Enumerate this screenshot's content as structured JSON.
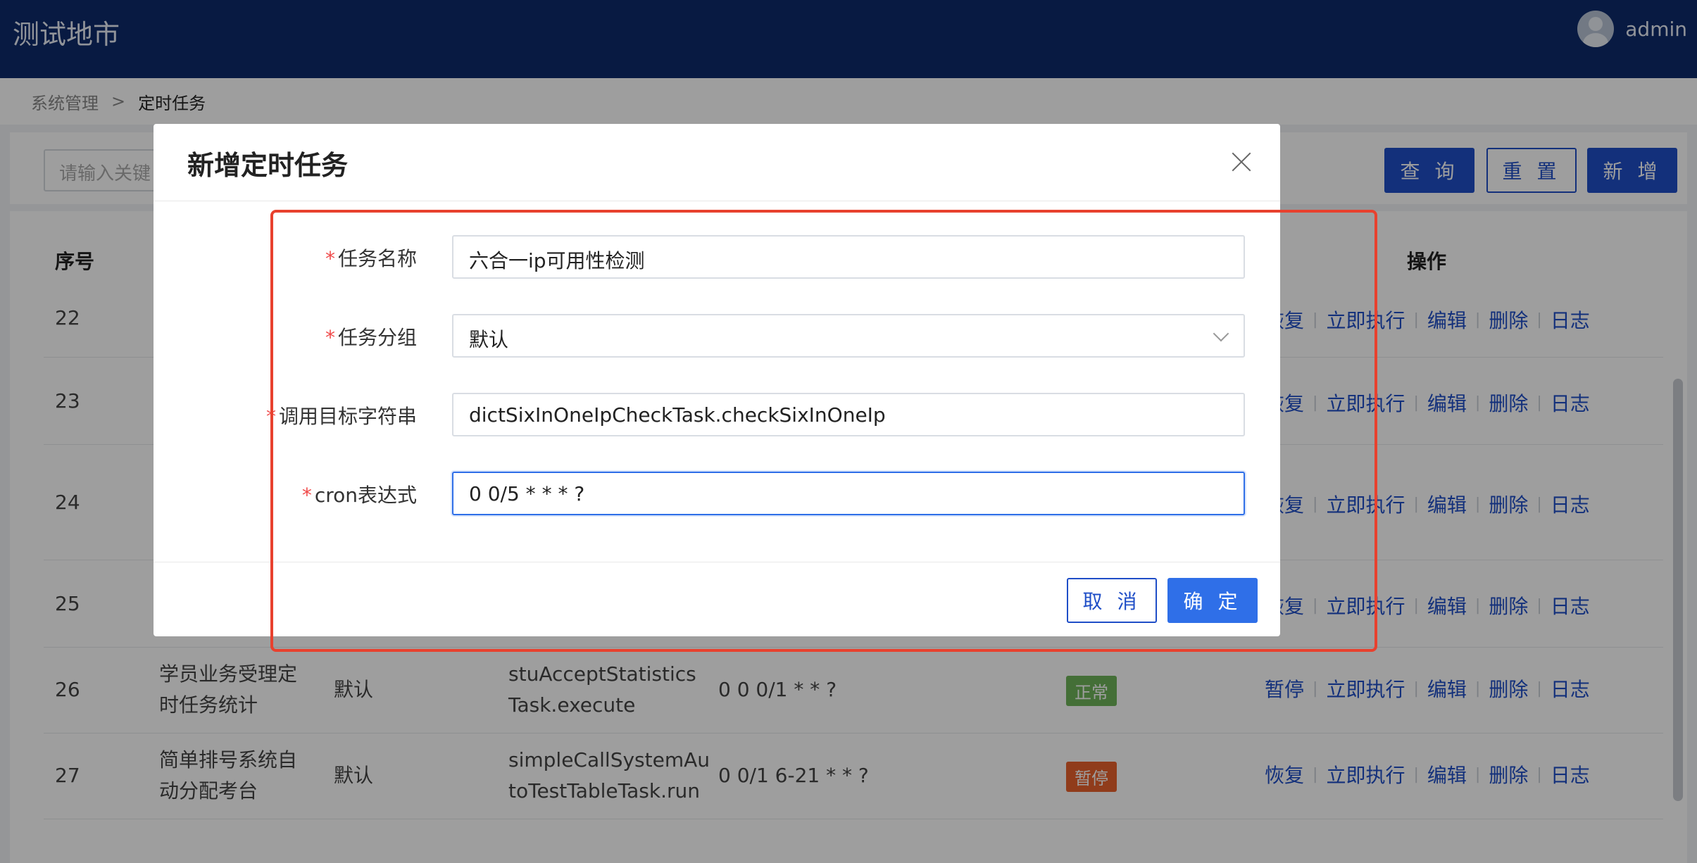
{
  "header": {
    "app_title": "测试地市",
    "username": "admin"
  },
  "breadcrumb": {
    "parent": "系统管理",
    "separator": ">",
    "current": "定时任务"
  },
  "search": {
    "placeholder": "请输入关键",
    "query_label": "查 询",
    "reset_label": "重 置",
    "add_label": "新 增"
  },
  "table": {
    "headers": {
      "index": "序号",
      "operations": "操作"
    },
    "rows": [
      {
        "index": "22",
        "ops": [
          "恢复",
          "立即执行",
          "编辑",
          "删除",
          "日志"
        ]
      },
      {
        "index": "23",
        "ops": [
          "恢复",
          "立即执行",
          "编辑",
          "删除",
          "日志"
        ]
      },
      {
        "index": "24",
        "ops": [
          "恢复",
          "立即执行",
          "编辑",
          "删除",
          "日志"
        ]
      },
      {
        "index": "25",
        "ops": [
          "恢复",
          "立即执行",
          "编辑",
          "删除",
          "日志"
        ]
      },
      {
        "index": "26",
        "name_line1": "学员业务受理定",
        "name_line2": "时任务统计",
        "group": "默认",
        "target_line1": "stuAcceptStatistics",
        "target_line2": "Task.execute",
        "cron": "0 0 0/1 * * ?",
        "status": "正常",
        "status_color": "#6fb35a",
        "ops": [
          "暂停",
          "立即执行",
          "编辑",
          "删除",
          "日志"
        ]
      },
      {
        "index": "27",
        "name_line1": "简单排号系统自",
        "name_line2": "动分配考台",
        "group": "默认",
        "target_line1": "simpleCallSystemAu",
        "target_line2": "toTestTableTask.run",
        "cron": "0 0/1 6-21 * * ?",
        "status": "暂停",
        "status_color": "#e8612c",
        "ops": [
          "恢复",
          "立即执行",
          "编辑",
          "删除",
          "日志"
        ]
      }
    ]
  },
  "modal": {
    "title": "新增定时任务",
    "required_mark": "*",
    "fields": {
      "task_name": {
        "label": "任务名称",
        "value": "六合一ip可用性检测"
      },
      "task_group": {
        "label": "任务分组",
        "value": "默认"
      },
      "invoke_target": {
        "label": "调用目标字符串",
        "value": "dictSixInOneIpCheckTask.checkSixInOneIp"
      },
      "cron": {
        "label": "cron表达式",
        "value": "0 0/5 * * * ?"
      }
    },
    "cancel_label": "取 消",
    "ok_label": "确 定"
  },
  "colors": {
    "header_bg": "#0d2a6b",
    "primary": "#1f4ec7",
    "highlight": "#e8412e"
  }
}
